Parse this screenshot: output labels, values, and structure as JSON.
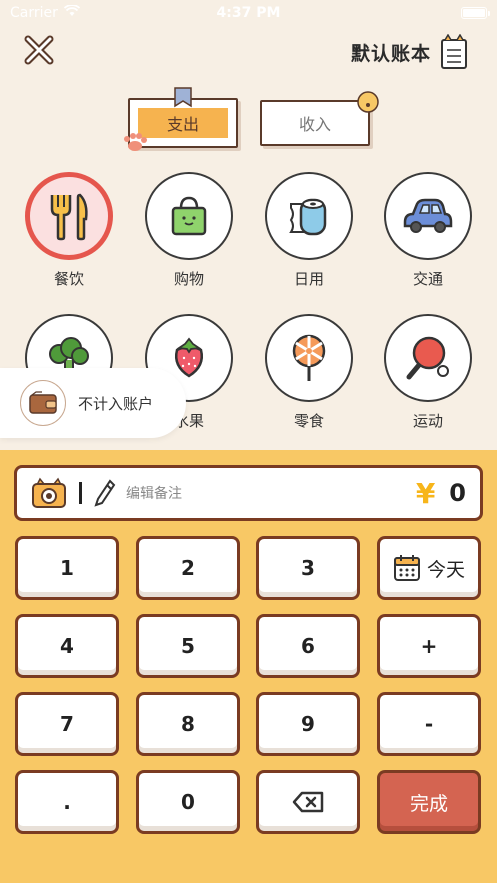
{
  "status": {
    "carrier": "Carrier",
    "time": "4:37 PM"
  },
  "header": {
    "book_title": "默认账本"
  },
  "tabs": {
    "expense": "支出",
    "income": "收入"
  },
  "categories": [
    {
      "label": "餐饮",
      "icon": "fork-knife-icon",
      "selected": true
    },
    {
      "label": "购物",
      "icon": "shopping-bag-icon",
      "selected": false
    },
    {
      "label": "日用",
      "icon": "toilet-paper-icon",
      "selected": false
    },
    {
      "label": "交通",
      "icon": "car-icon",
      "selected": false
    },
    {
      "label": "",
      "icon": "vegetable-icon",
      "selected": false
    },
    {
      "label": "水果",
      "icon": "strawberry-icon",
      "selected": false
    },
    {
      "label": "零食",
      "icon": "lollipop-icon",
      "selected": false
    },
    {
      "label": "运动",
      "icon": "ping-pong-icon",
      "selected": false
    }
  ],
  "side_tag": {
    "label": "不计入账户"
  },
  "note": {
    "placeholder": "编辑备注",
    "currency": "¥",
    "amount": "0"
  },
  "keys": {
    "k1": "1",
    "k2": "2",
    "k3": "3",
    "today": "今天",
    "k4": "4",
    "k5": "5",
    "k6": "6",
    "plus": "+",
    "k7": "7",
    "k8": "8",
    "k9": "9",
    "minus": "-",
    "dot": ".",
    "k0": "0",
    "done": "完成"
  },
  "colors": {
    "accent": "#f6b34f",
    "keypad_bg": "#f8c865",
    "done": "#d46451",
    "selected_ring": "#e5564d"
  }
}
